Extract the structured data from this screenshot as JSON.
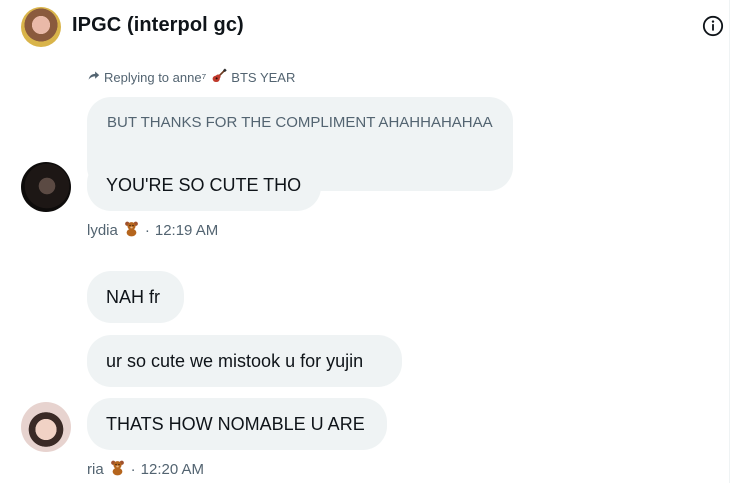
{
  "header": {
    "title": "IPGC (interpol gc)",
    "avatar_icon": "group-avatar",
    "info_icon": "info-icon"
  },
  "reply_context": {
    "prefix": "Replying to anne⁷",
    "emoji_icon": "guitar-icon",
    "suffix": "BTS YEAR",
    "quoted_text": "BUT THANKS FOR THE COMPLIMENT AHAHHAHAHAA"
  },
  "messages": [
    {
      "sender_avatar": "lydia-avatar",
      "bubbles": [
        "YOU'RE SO CUTE THO"
      ],
      "meta": {
        "name": "lydia",
        "emoji_icon": "teddy-bear-icon",
        "separator": "·",
        "time": "12:19 AM"
      }
    },
    {
      "sender_avatar": "ria-avatar",
      "bubbles": [
        "NAH fr",
        "ur so cute we mistook u for yujin",
        "THATS HOW NOMABLE U ARE"
      ],
      "meta": {
        "name": "ria",
        "emoji_icon": "teddy-bear-icon",
        "separator": "·",
        "time": "12:20 AM"
      }
    }
  ],
  "colors": {
    "bubble_bg": "#eff3f4",
    "text_primary": "#0f1419",
    "text_secondary": "#536471"
  }
}
